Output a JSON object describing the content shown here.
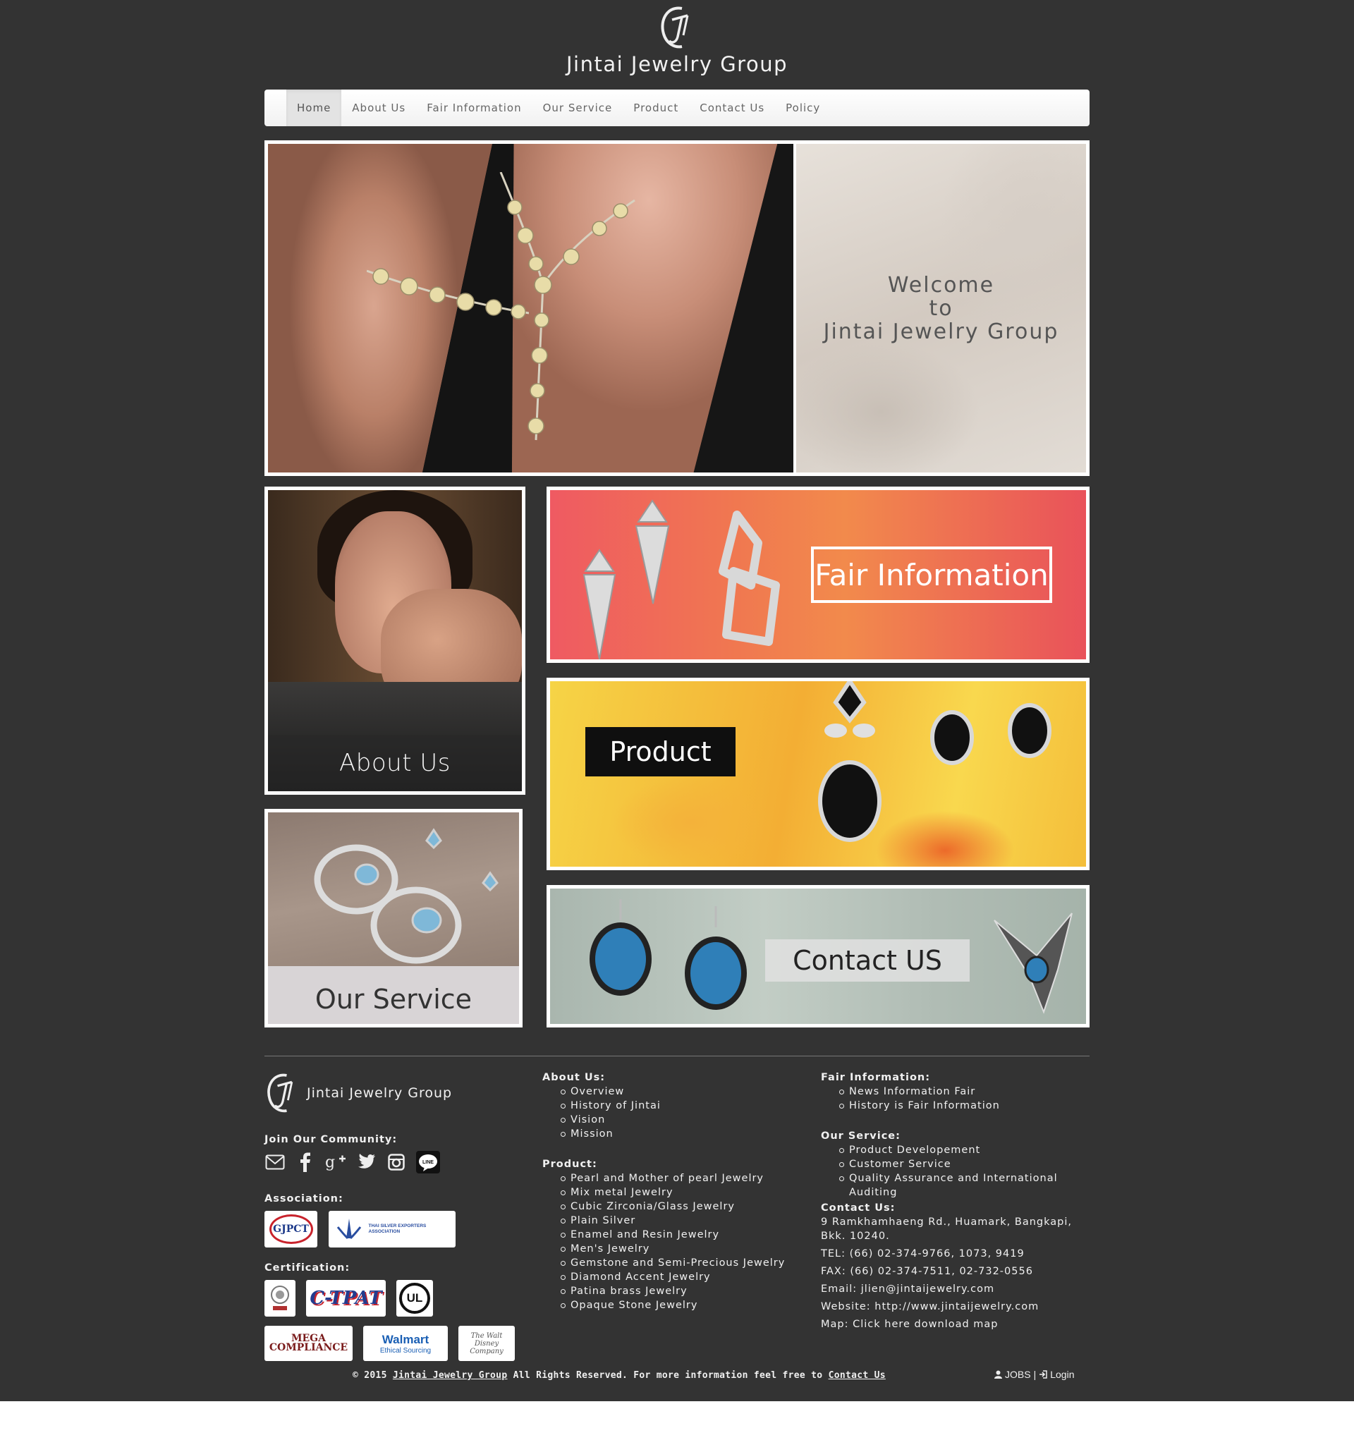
{
  "brand": {
    "logo_letters": "JT",
    "name": "Jintai Jewelry Group"
  },
  "nav": {
    "items": [
      {
        "label": "Home",
        "active": true
      },
      {
        "label": "About Us"
      },
      {
        "label": "Fair Information"
      },
      {
        "label": "Our Service"
      },
      {
        "label": "Product"
      },
      {
        "label": "Contact Us"
      },
      {
        "label": "Policy"
      }
    ]
  },
  "hero": {
    "welcome_lines": [
      "Welcome",
      "to",
      "Jintai Jewelry Group"
    ]
  },
  "tiles": {
    "about": "About Us",
    "fair": "Fair Information",
    "product": "Product",
    "service": "Our Service",
    "contact": "Contact US"
  },
  "footer": {
    "brand_name": "Jintai Jewelry Group",
    "community_head": "Join Our Community:",
    "social_icons": [
      "mail-icon",
      "facebook-icon",
      "google-plus-icon",
      "twitter-icon",
      "instagram-icon",
      "line-icon"
    ],
    "line_label": "LINE",
    "association_head": "Association:",
    "associations": [
      "GJPCT",
      "THAI SILVER EXPORTERS ASSOCIATION"
    ],
    "certification_head": "Certification:",
    "certifications": [
      "C-TPAT",
      "UL",
      "MEGA COMPLIANCE",
      "Walmart",
      "Ethical Sourcing",
      "The Walt Disney Company"
    ],
    "about_us": {
      "head": "About Us:",
      "items": [
        "Overview",
        "History of Jintai",
        "Vision",
        "Mission"
      ]
    },
    "product": {
      "head": "Product:",
      "items": [
        "Pearl and Mother of pearl Jewelry",
        "Mix metal Jewelry",
        "Cubic Zirconia/Glass Jewelry",
        "Plain Silver",
        "Enamel and Resin Jewelry",
        "Men's Jewelry",
        "Gemstone and Semi-Precious Jewelry",
        "Diamond Accent Jewelry",
        "Patina brass Jewelry",
        "Opaque Stone Jewelry"
      ]
    },
    "fair_info": {
      "head": "Fair Information:",
      "items": [
        "News Information Fair",
        "History is Fair Information"
      ]
    },
    "our_service": {
      "head": "Our Service:",
      "items": [
        "Product Developement",
        "Customer Service",
        "Quality Assurance and International",
        "Auditing"
      ]
    },
    "contact": {
      "head": "Contact Us:",
      "address_1": "9 Ramkhamhaeng Rd., Huamark, Bangkapi,",
      "address_2": "Bkk. 10240.",
      "tel": "TEL: (66) 02-374-9766, 1073, 9419",
      "fax": "FAX: (66) 02-374-7511, 02-732-0556",
      "email": "Email: jlien@jintaijewelry.com",
      "website": "Website: http://www.jintaijewelry.com",
      "map": "Map: Click here download map"
    },
    "copyright_prefix": "© 2015",
    "copyright_link": "Jintai Jewelry Group",
    "copyright_mid": "All Rights Reserved. For more information feel free to",
    "copyright_contact": "Contact Us",
    "jobs": "JOBS",
    "separator": "|",
    "login": "Login"
  }
}
